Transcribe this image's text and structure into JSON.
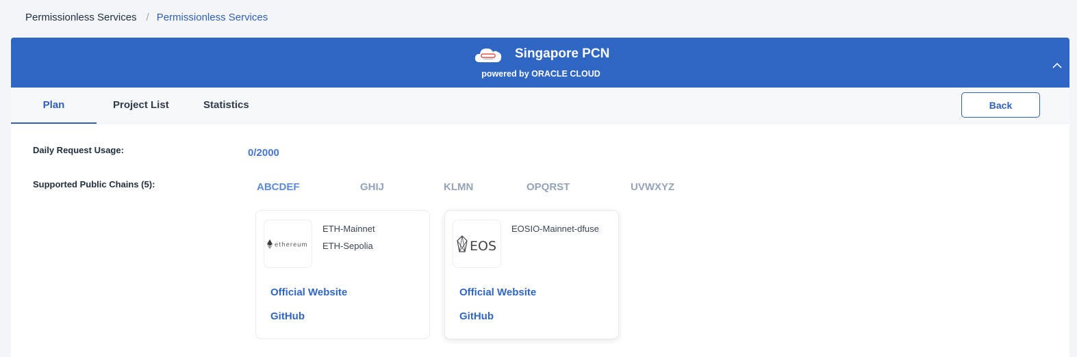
{
  "breadcrumb": {
    "root": "Permissionless Services",
    "separator": "/",
    "current": "Permissionless Services"
  },
  "banner": {
    "title": "Singapore PCN",
    "subtitle": "powered by ORACLE CLOUD",
    "logo_icon": "oracle-cloud-icon",
    "collapse_icon": "chevron-up-icon",
    "color": "#2f66c4"
  },
  "tabs": [
    {
      "label": "Plan",
      "active": true
    },
    {
      "label": "Project List",
      "active": false
    },
    {
      "label": "Statistics",
      "active": false
    }
  ],
  "back_label": "Back",
  "usage": {
    "label": "Daily Request Usage:",
    "value": "0/2000"
  },
  "chains": {
    "label": "Supported Public Chains (5):",
    "groups": [
      "ABCDEF",
      "GHIJ",
      "KLMN",
      "OPQRST",
      "UVWXYZ"
    ],
    "cards": [
      {
        "logo": "ethereum-logo",
        "logo_text": "ethereum",
        "networks": [
          "ETH-Mainnet",
          "ETH-Sepolia"
        ],
        "website_label": "Official Website",
        "github_label": "GitHub"
      },
      {
        "logo": "eos-logo",
        "logo_text": "EOS",
        "networks": [
          "EOSIO-Mainnet-dfuse"
        ],
        "website_label": "Official Website",
        "github_label": "GitHub"
      }
    ]
  }
}
